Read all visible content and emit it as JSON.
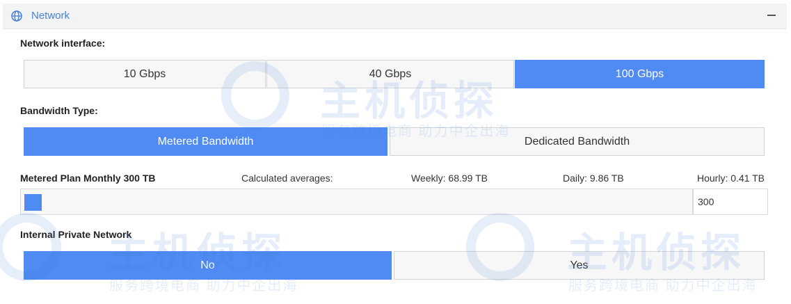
{
  "section": {
    "title": "Network",
    "icon": "globe-icon",
    "collapse_icon": "minus-icon"
  },
  "network_interface": {
    "label": "Network interface:",
    "options": [
      "10 Gbps",
      "40 Gbps",
      "100 Gbps"
    ],
    "selected": "100 Gbps"
  },
  "bandwidth_type": {
    "label": "Bandwidth Type:",
    "options": [
      "Metered Bandwidth",
      "Dedicated Bandwidth"
    ],
    "selected": "Metered Bandwidth"
  },
  "metered_plan": {
    "label": "Metered Plan Monthly 300 TB",
    "calculated_label": "Calculated averages:",
    "weekly": "Weekly: 68.99 TB",
    "daily": "Daily: 9.86 TB",
    "hourly": "Hourly: 0.41 TB",
    "value": "300",
    "slider_fraction": 0.0
  },
  "private_network": {
    "label": "Internal Private Network",
    "options": [
      "No",
      "Yes"
    ],
    "selected": "No"
  },
  "watermark": {
    "main": "主机侦探",
    "sub": "服务跨境电商 助力中企出海"
  },
  "colors": {
    "accent": "#4f8bf2",
    "header_bg": "#f2f3f5",
    "title": "#4a7fd8"
  }
}
